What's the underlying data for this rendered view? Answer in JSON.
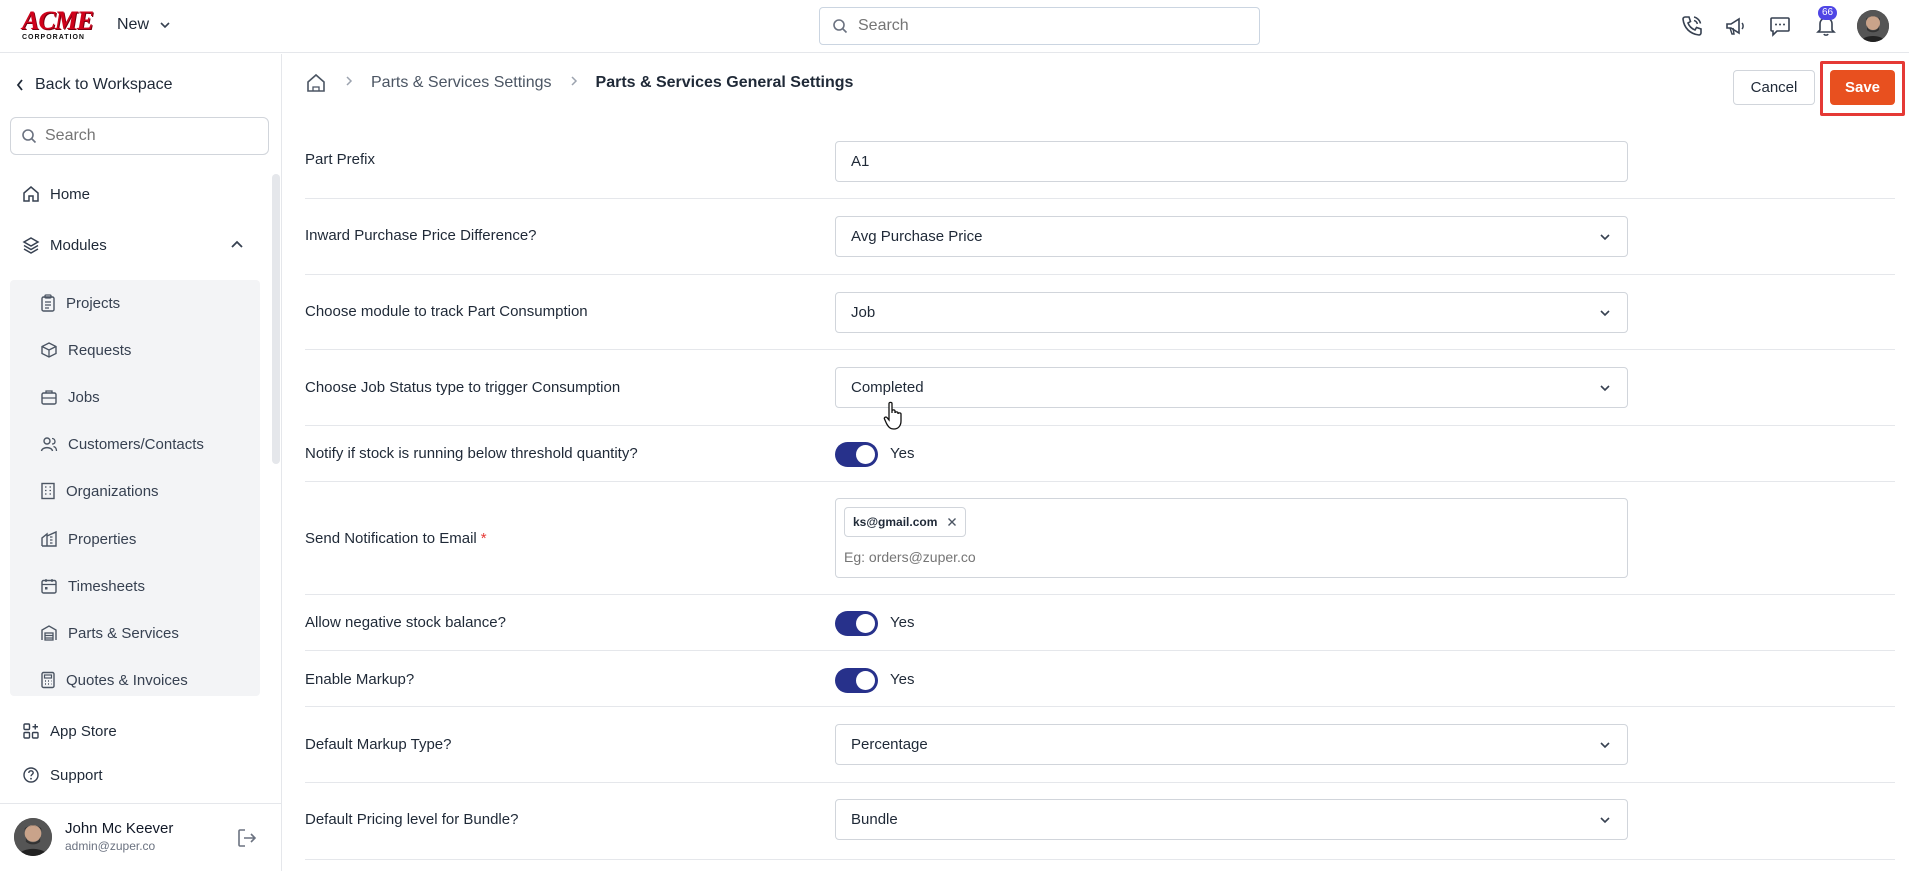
{
  "header": {
    "logo_text": "ACME",
    "logo_subtext": "CORPORATION",
    "new_label": "New",
    "search_placeholder": "Search",
    "notification_count": "66"
  },
  "sidebar": {
    "back_label": "Back to Workspace",
    "search_placeholder": "Search",
    "home_label": "Home",
    "modules_label": "Modules",
    "modules": [
      {
        "label": "Projects",
        "icon": "clipboard-icon"
      },
      {
        "label": "Requests",
        "icon": "box-icon"
      },
      {
        "label": "Jobs",
        "icon": "briefcase-icon"
      },
      {
        "label": "Customers/Contacts",
        "icon": "users-icon"
      },
      {
        "label": "Organizations",
        "icon": "building-icon"
      },
      {
        "label": "Properties",
        "icon": "property-icon"
      },
      {
        "label": "Timesheets",
        "icon": "calendar-icon"
      },
      {
        "label": "Parts & Services",
        "icon": "warehouse-icon"
      },
      {
        "label": "Quotes & Invoices",
        "icon": "calculator-icon"
      }
    ],
    "app_store_label": "App Store",
    "support_label": "Support",
    "user": {
      "name": "John Mc Keever",
      "email": "admin@zuper.co"
    }
  },
  "breadcrumb": {
    "parent": "Parts & Services Settings",
    "current": "Parts & Services General Settings"
  },
  "actions": {
    "cancel": "Cancel",
    "save": "Save"
  },
  "settings": {
    "part_prefix": {
      "label": "Part Prefix",
      "value": "A1"
    },
    "inward_price": {
      "label": "Inward Purchase Price Difference?",
      "value": "Avg Purchase Price"
    },
    "track_module": {
      "label": "Choose module to track Part Consumption",
      "value": "Job"
    },
    "job_status": {
      "label": "Choose Job Status type to trigger Consumption",
      "value": "Completed"
    },
    "notify_stock": {
      "label": "Notify if stock is running below threshold quantity?",
      "value": "Yes",
      "on": true
    },
    "notify_email": {
      "label": "Send Notification to Email",
      "required_mark": "*",
      "chip": "ks@gmail.com",
      "placeholder": "Eg: orders@zuper.co"
    },
    "negative_stock": {
      "label": "Allow negative stock balance?",
      "value": "Yes",
      "on": true
    },
    "enable_markup": {
      "label": "Enable Markup?",
      "value": "Yes",
      "on": true
    },
    "markup_type": {
      "label": "Default Markup Type?",
      "value": "Percentage"
    },
    "bundle_pricing": {
      "label": "Default Pricing level for Bundle?",
      "value": "Bundle"
    }
  },
  "colors": {
    "accent": "#e8501f",
    "toggle": "#27318b",
    "highlight": "#e53935"
  }
}
